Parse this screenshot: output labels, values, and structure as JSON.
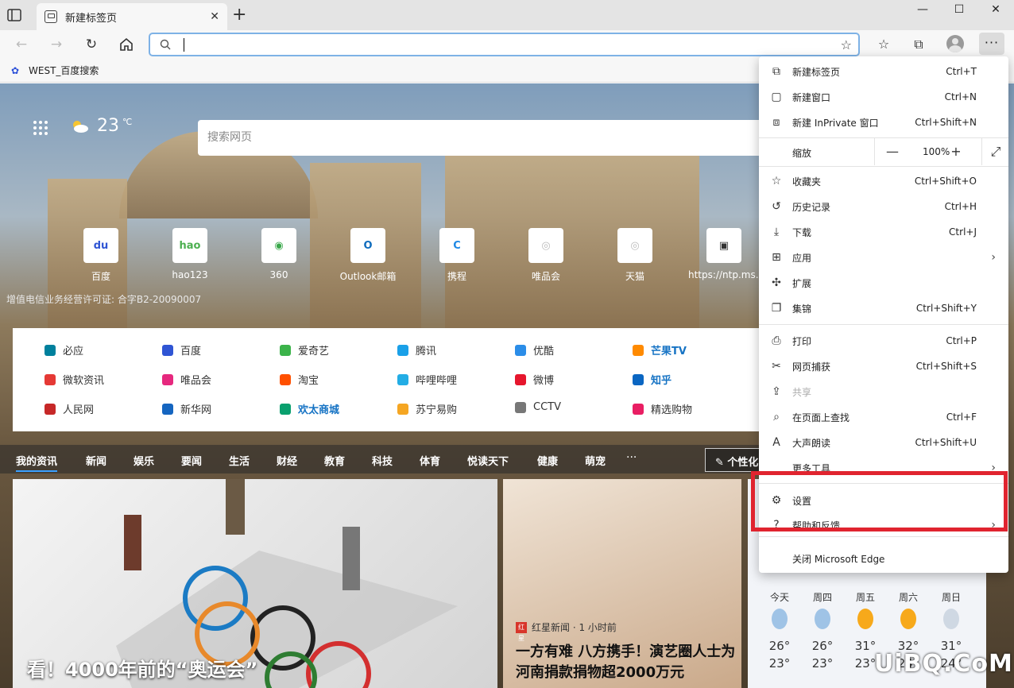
{
  "tab": {
    "title": "新建标签页"
  },
  "window_controls": {
    "minimize": "—",
    "maximize": "☐",
    "close": "✕"
  },
  "address": {
    "value": ""
  },
  "bookmarks": [
    {
      "label": "WEST_百度搜索"
    }
  ],
  "weather": {
    "temp": "23",
    "unit": "℃"
  },
  "search": {
    "placeholder": "搜索网页"
  },
  "quick_links": [
    {
      "label": "百度",
      "icon": "du",
      "color": "#2f55d4"
    },
    {
      "label": "hao123",
      "icon": "hao",
      "color": "#4caf50"
    },
    {
      "label": "360",
      "icon": "◉",
      "color": "#3aa84b"
    },
    {
      "label": "Outlook邮箱",
      "icon": "O",
      "color": "#0f6cbd"
    },
    {
      "label": "携程",
      "icon": "C",
      "color": "#1e88e5"
    },
    {
      "label": "唯品会",
      "icon": "◎",
      "color": "#bbbbbb"
    },
    {
      "label": "天猫",
      "icon": "◎",
      "color": "#bbbbbb"
    },
    {
      "label": "https://ntp.ms...",
      "icon": "▣",
      "color": "#333333"
    }
  ],
  "license_text": "增值电信业务经营许可证: 合字B2-20090007",
  "sites": [
    [
      {
        "label": "必应",
        "color": "#00809d",
        "hl": false
      },
      {
        "label": "百度",
        "color": "#2f55d4",
        "hl": false
      },
      {
        "label": "爱奇艺",
        "color": "#3bb34a",
        "hl": false
      },
      {
        "label": "腾讯",
        "color": "#1aa0e8",
        "hl": false
      },
      {
        "label": "优酷",
        "color": "#2b8de8",
        "hl": false
      },
      {
        "label": "芒果TV",
        "color": "#ff8a00",
        "hl": true
      }
    ],
    [
      {
        "label": "微软资讯",
        "color": "#e53935",
        "hl": false
      },
      {
        "label": "唯品会",
        "color": "#e6287e",
        "hl": false
      },
      {
        "label": "淘宝",
        "color": "#ff5000",
        "hl": false
      },
      {
        "label": "哔哩哔哩",
        "color": "#23ade5",
        "hl": false
      },
      {
        "label": "微博",
        "color": "#e6162d",
        "hl": false
      },
      {
        "label": "知乎",
        "color": "#0a66c2",
        "hl": true
      }
    ],
    [
      {
        "label": "人民网",
        "color": "#c62828",
        "hl": false
      },
      {
        "label": "新华网",
        "color": "#1565c0",
        "hl": false
      },
      {
        "label": "欢太商城",
        "color": "#0aa06e",
        "hl": true
      },
      {
        "label": "苏宁易购",
        "color": "#f5a623",
        "hl": false
      },
      {
        "label": "CCTV",
        "color": "#777777",
        "hl": false
      },
      {
        "label": "精选购物",
        "color": "#e91e63",
        "hl": false
      }
    ]
  ],
  "news_nav": [
    "我的资讯",
    "新闻",
    "娱乐",
    "要闻",
    "生活",
    "财经",
    "教育",
    "科技",
    "体育",
    "悦读天下",
    "健康",
    "萌宠"
  ],
  "news_more": "···",
  "personalize": "个性化",
  "cards": {
    "main_title": "看！4000年前的“奥运会”",
    "side_source": "红星新闻 · 1 小时前",
    "side_title": "一方有难 八方携手！演艺圈人士为河南捐款捐物超2000万元"
  },
  "forecast": [
    {
      "day": "今天",
      "hi": "26°",
      "lo": "23°",
      "icon": "rain",
      "color": "#9fc3e6"
    },
    {
      "day": "周四",
      "hi": "26°",
      "lo": "23°",
      "icon": "rain",
      "color": "#9fc3e6"
    },
    {
      "day": "周五",
      "hi": "31°",
      "lo": "23°",
      "icon": "sun",
      "color": "#f7a91b"
    },
    {
      "day": "周六",
      "hi": "32°",
      "lo": "24°",
      "icon": "sun",
      "color": "#f7a91b"
    },
    {
      "day": "周日",
      "hi": "31°",
      "lo": "24°",
      "icon": "cloud",
      "color": "#cfd8e3"
    }
  ],
  "watermark": "UiBQ.CoM",
  "menu": {
    "items_top": [
      {
        "label": "新建标签页",
        "shortcut": "Ctrl+T",
        "icon": "new-tab-icon",
        "glyph": "⧉"
      },
      {
        "label": "新建窗口",
        "shortcut": "Ctrl+N",
        "icon": "new-window-icon",
        "glyph": "▢"
      },
      {
        "label": "新建 InPrivate 窗口",
        "shortcut": "Ctrl+Shift+N",
        "icon": "inprivate-icon",
        "glyph": "⧈"
      }
    ],
    "zoom_label": "缩放",
    "zoom_value": "100%",
    "items_mid": [
      {
        "label": "收藏夹",
        "shortcut": "Ctrl+Shift+O",
        "icon": "favorites-icon",
        "glyph": "☆"
      },
      {
        "label": "历史记录",
        "shortcut": "Ctrl+H",
        "icon": "history-icon",
        "glyph": "↺"
      },
      {
        "label": "下载",
        "shortcut": "Ctrl+J",
        "icon": "download-icon",
        "glyph": "⤓"
      },
      {
        "label": "应用",
        "shortcut": "",
        "icon": "apps-icon",
        "glyph": "⊞",
        "arrow": true
      },
      {
        "label": "扩展",
        "shortcut": "",
        "icon": "extensions-icon",
        "glyph": "✣"
      },
      {
        "label": "集锦",
        "shortcut": "Ctrl+Shift+Y",
        "icon": "collections-icon",
        "glyph": "❐"
      }
    ],
    "items_low": [
      {
        "label": "打印",
        "shortcut": "Ctrl+P",
        "icon": "print-icon",
        "glyph": "⎙"
      },
      {
        "label": "网页捕获",
        "shortcut": "Ctrl+Shift+S",
        "icon": "capture-icon",
        "glyph": "✂"
      },
      {
        "label": "共享",
        "shortcut": "",
        "icon": "share-icon",
        "glyph": "⇪",
        "disabled": true
      },
      {
        "label": "在页面上查找",
        "shortcut": "Ctrl+F",
        "icon": "find-icon",
        "glyph": "⌕"
      },
      {
        "label": "大声朗读",
        "shortcut": "Ctrl+Shift+U",
        "icon": "read-aloud-icon",
        "glyph": "A"
      },
      {
        "label": "更多工具",
        "shortcut": "",
        "icon": "more-tools-icon",
        "glyph": "",
        "arrow": true
      }
    ],
    "settings": {
      "label": "设置",
      "icon": "gear-icon",
      "glyph": "⚙"
    },
    "help": {
      "label": "帮助和反馈",
      "icon": "help-icon",
      "glyph": "?"
    },
    "close": {
      "label": "关闭 Microsoft Edge"
    }
  }
}
